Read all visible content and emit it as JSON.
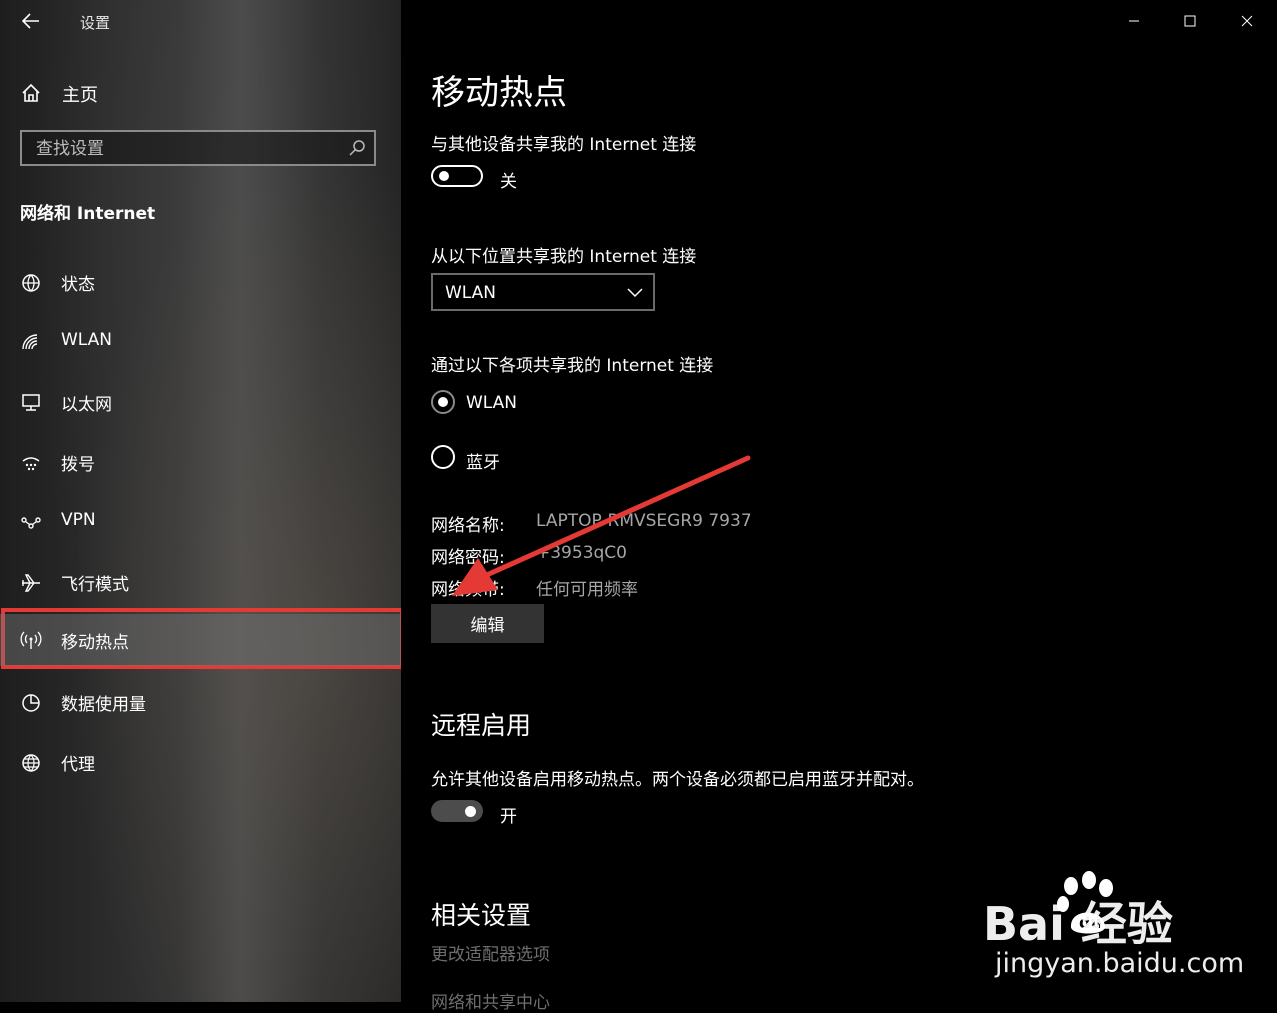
{
  "window": {
    "title": "设置"
  },
  "sidebar": {
    "home_label": "主页",
    "search_placeholder": "查找设置",
    "section_title": "网络和 Internet",
    "items": [
      {
        "label": "状态",
        "icon": "globe-status-icon"
      },
      {
        "label": "WLAN",
        "icon": "wifi-icon"
      },
      {
        "label": "以太网",
        "icon": "ethernet-icon"
      },
      {
        "label": "拨号",
        "icon": "dialup-icon"
      },
      {
        "label": "VPN",
        "icon": "vpn-icon"
      },
      {
        "label": "飞行模式",
        "icon": "airplane-icon"
      },
      {
        "label": "移动热点",
        "icon": "hotspot-icon",
        "selected": true
      },
      {
        "label": "数据使用量",
        "icon": "data-usage-icon"
      },
      {
        "label": "代理",
        "icon": "proxy-globe-icon"
      }
    ]
  },
  "main": {
    "title": "移动热点",
    "share_label": "与其他设备共享我的 Internet 连接",
    "share_toggle": {
      "state": "off",
      "label": "关"
    },
    "source_label": "从以下位置共享我的 Internet 连接",
    "source_value": "WLAN",
    "via_label": "通过以下各项共享我的 Internet 连接",
    "via_options": [
      {
        "label": "WLAN",
        "checked": true
      },
      {
        "label": "蓝牙",
        "checked": false
      }
    ],
    "details": [
      {
        "label": "网络名称:",
        "value": "LAPTOP-RMVSEGR9 7937"
      },
      {
        "label": "网络密码:",
        "value": "+3953qC0"
      },
      {
        "label": "网络频带:",
        "value": "任何可用频率"
      }
    ],
    "edit_label": "编辑",
    "remote_title": "远程启用",
    "remote_desc": "允许其他设备启用移动热点。两个设备必须都已启用蓝牙并配对。",
    "remote_toggle": {
      "state": "on",
      "label": "开"
    },
    "related_title": "相关设置",
    "related_links": [
      "更改适配器选项",
      "网络和共享中心"
    ]
  },
  "watermark": {
    "title": "Bai  经验",
    "subtitle": "jingyan.baidu.com"
  },
  "colors": {
    "highlight": "#e53935",
    "arrow": "#e53935"
  }
}
